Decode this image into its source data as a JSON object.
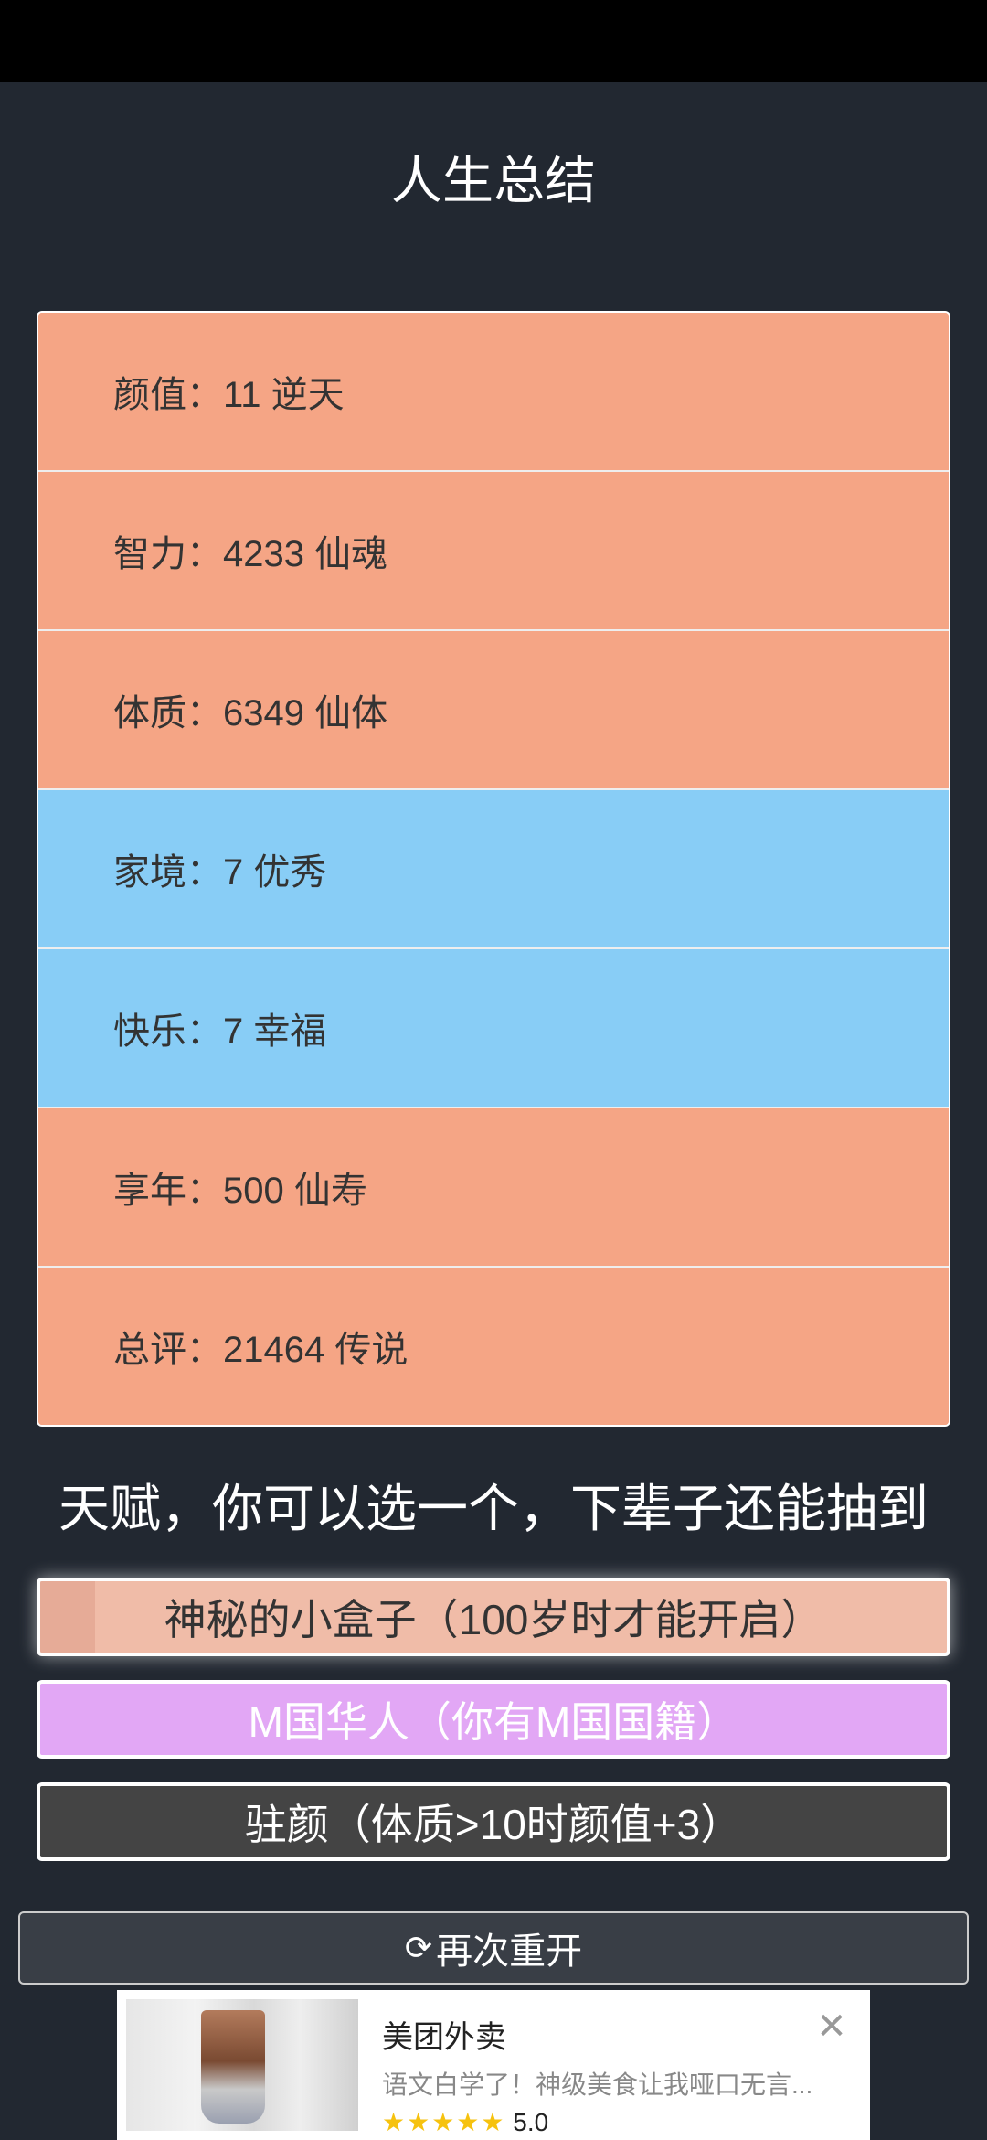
{
  "header": {
    "title": "人生总结"
  },
  "stats": [
    {
      "text": "颜值：11 逆天",
      "color": "#f5a585"
    },
    {
      "text": "智力：4233 仙魂",
      "color": "#f5a585"
    },
    {
      "text": "体质：6349 仙体",
      "color": "#f5a585"
    },
    {
      "text": "家境：7 优秀",
      "color": "#88cdf6"
    },
    {
      "text": "快乐：7 幸福",
      "color": "#88cdf6"
    },
    {
      "text": "享年：500 仙寿",
      "color": "#f5a585"
    },
    {
      "text": "总评：21464 传说",
      "color": "#f5a585"
    }
  ],
  "talents": {
    "heading": "天赋，你可以选一个，下辈子还能抽到",
    "options": [
      {
        "label": "神秘的小盒子（100岁时才能开启）",
        "color": "#f0bca8",
        "selected": true
      },
      {
        "label": "M国华人（你有M国国籍）",
        "color": "#e2a7f5"
      },
      {
        "label": "驻颜（体质>10时颜值+3）",
        "color": "#444444"
      }
    ]
  },
  "restart": {
    "icon": "refresh-icon",
    "label": "再次重开"
  },
  "ad": {
    "name": "美团外卖",
    "description": "语文白学了！神级美食让我哑口无言...",
    "stars": "★★★★★",
    "rating": "5.0",
    "close_icon": "close-icon"
  }
}
